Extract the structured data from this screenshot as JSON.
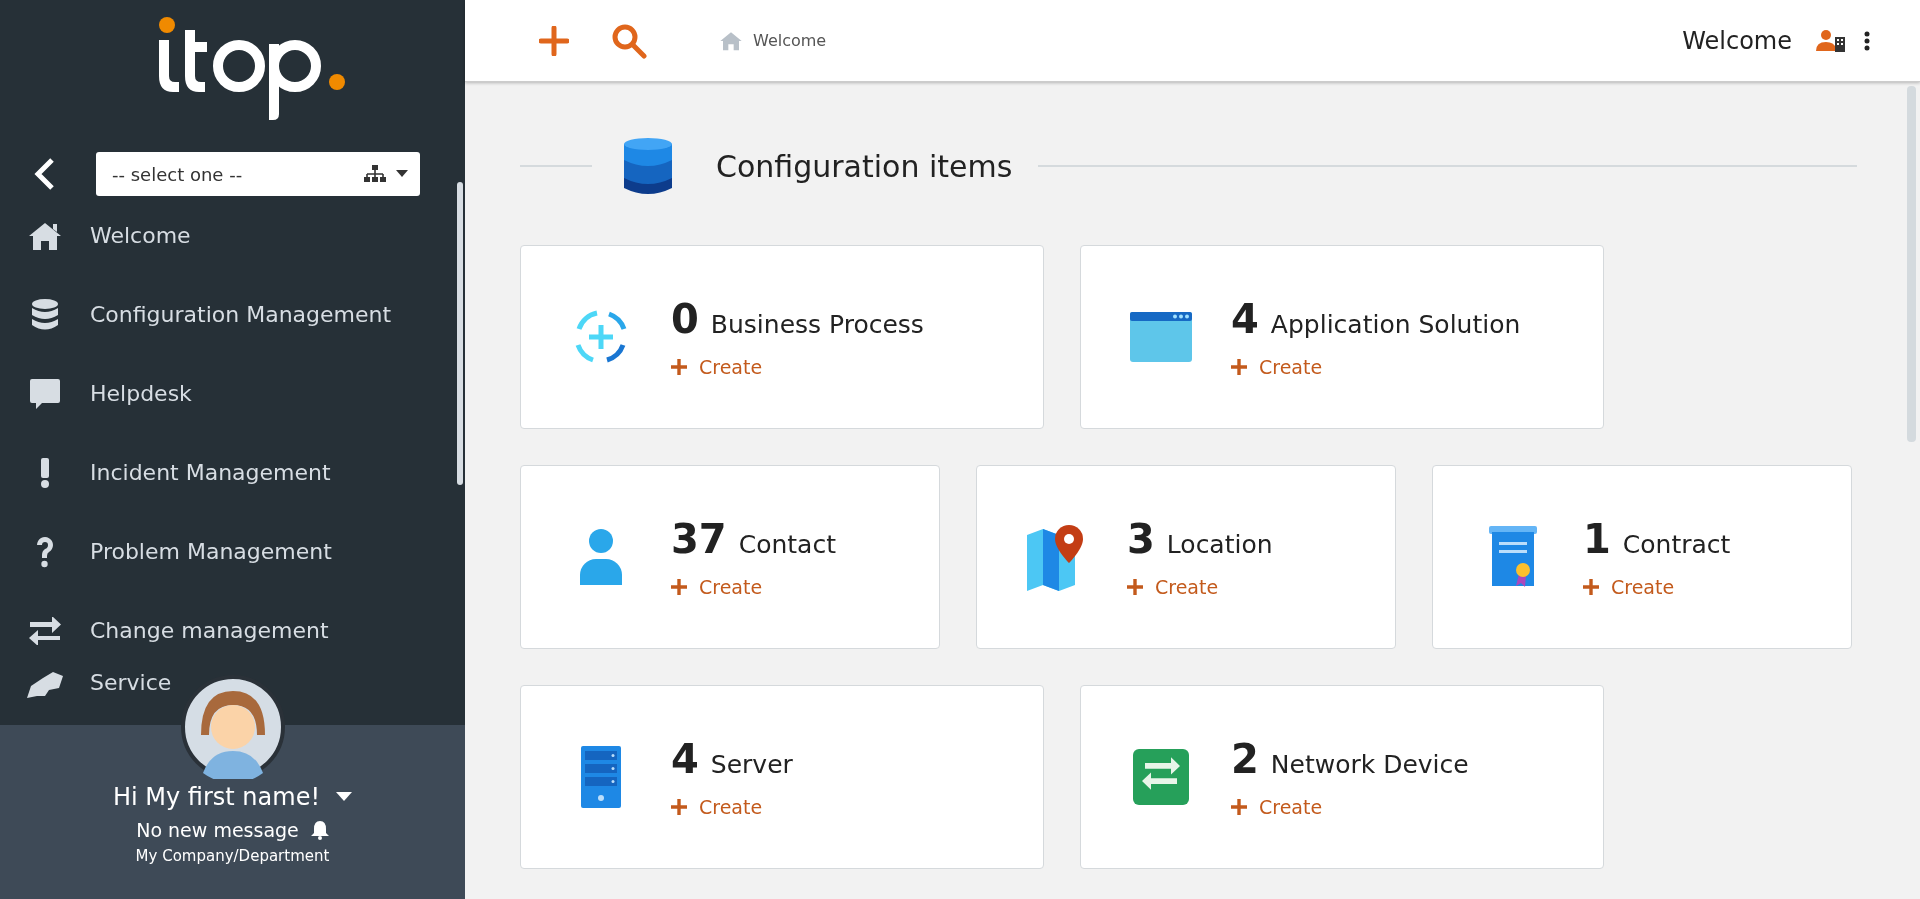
{
  "sidebar": {
    "organization_select": {
      "value": "-- select one --"
    },
    "menu": [
      {
        "label": "Welcome"
      },
      {
        "label": "Configuration Management"
      },
      {
        "label": "Helpdesk"
      },
      {
        "label": "Incident Management"
      },
      {
        "label": "Problem Management"
      },
      {
        "label": "Change management"
      },
      {
        "label": "Service"
      }
    ],
    "user": {
      "greeting": "Hi My first name!",
      "messages": "No new message",
      "organization": "My Company/Department"
    }
  },
  "header": {
    "breadcrumb": "Welcome",
    "page_title": "Welcome"
  },
  "section": {
    "title": "Configuration items"
  },
  "card_rows": [
    [
      {
        "count": "0",
        "label": "Business Process",
        "action": "Create"
      },
      {
        "count": "4",
        "label": "Application Solution",
        "action": "Create"
      }
    ],
    [
      {
        "count": "37",
        "label": "Contact",
        "action": "Create"
      },
      {
        "count": "3",
        "label": "Location",
        "action": "Create"
      },
      {
        "count": "1",
        "label": "Contract",
        "action": "Create"
      }
    ],
    [
      {
        "count": "4",
        "label": "Server",
        "action": "Create"
      },
      {
        "count": "2",
        "label": "Network Device",
        "action": "Create"
      }
    ]
  ]
}
